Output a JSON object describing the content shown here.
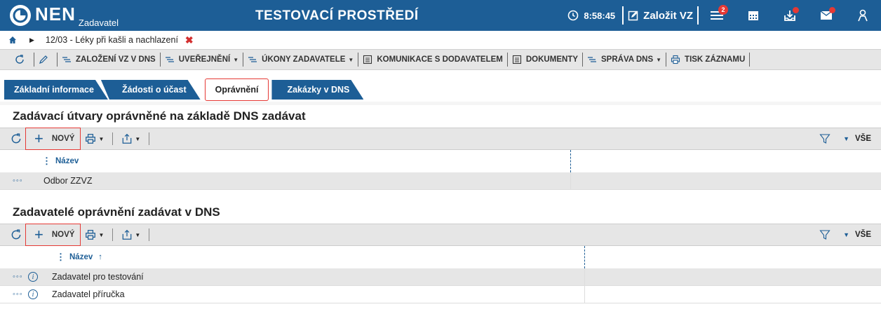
{
  "header": {
    "logo_text": "NEN",
    "logo_sub": "Zadavatel",
    "env_title": "TESTOVACÍ PROSTŘEDÍ",
    "time": "8:58:45",
    "create_label": "Založit VZ",
    "menu_badge": "2",
    "icons": [
      "clock-icon",
      "edit-icon",
      "menu-icon",
      "calendar-icon",
      "inbox-icon",
      "mail-icon",
      "user-icon"
    ],
    "accent": "#1d5e96",
    "alert_color": "#e53935"
  },
  "breadcrumb": {
    "current": "12/03 - Léky při kašli a nachlazení"
  },
  "toolbar": {
    "items": [
      {
        "label": "ZALOŽENÍ VZ V DNS",
        "caret": false
      },
      {
        "label": "UVEŘEJNĚNÍ",
        "caret": true
      },
      {
        "label": "ÚKONY ZADAVATELE",
        "caret": true
      },
      {
        "label": "KOMUNIKACE S DODAVATELEM",
        "caret": false
      },
      {
        "label": "DOKUMENTY",
        "caret": false
      },
      {
        "label": "SPRÁVA DNS",
        "caret": true
      },
      {
        "label": "TISK ZÁZNAMU",
        "caret": false
      }
    ]
  },
  "tabs": [
    "Základní informace",
    "Žádosti o účast",
    "Oprávnění",
    "Zakázky v DNS"
  ],
  "section1": {
    "title": "Zadávací útvary oprávněné na základě DNS zadávat",
    "new_label": "NOVÝ",
    "all_label": "VŠE",
    "column": "Název",
    "rows": [
      "Odbor ZZVZ"
    ]
  },
  "section2": {
    "title": "Zadavatelé oprávnění zadávat v DNS",
    "new_label": "NOVÝ",
    "all_label": "VŠE",
    "column": "Název",
    "sort_arrow": "↑",
    "rows": [
      "Zadavatel pro testování",
      "Zadavatel příručka"
    ]
  }
}
